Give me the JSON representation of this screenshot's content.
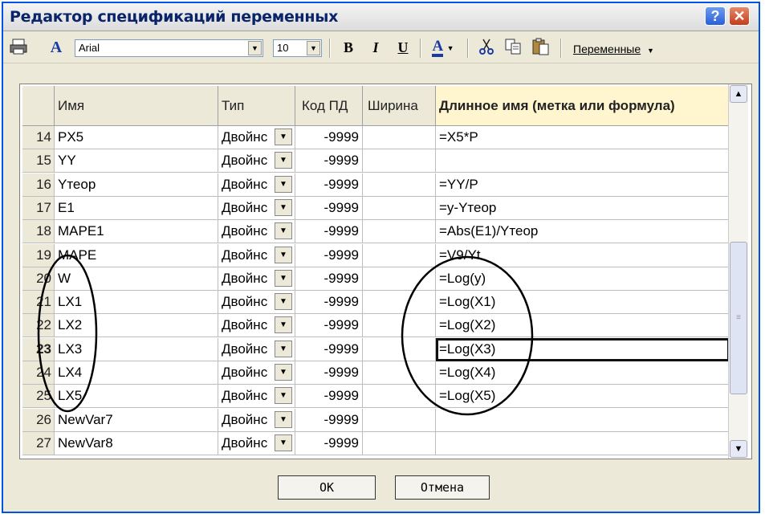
{
  "window": {
    "title": "Редактор спецификаций переменных"
  },
  "titlebar": {
    "help": "?",
    "close": "✕"
  },
  "toolbar": {
    "font_name": "Arial",
    "font_size": "10",
    "bold": "B",
    "italic": "I",
    "underline": "U",
    "font_color_letter": "A",
    "font_letter": "A",
    "variables_menu": "Переменные"
  },
  "grid": {
    "columns": [
      "Имя",
      "Тип",
      "Код ПД",
      "Ширина",
      "Длинное имя (метка или формула)"
    ],
    "rows": [
      {
        "num": "14",
        "name": "PX5",
        "type": "Двойнс",
        "code": "-9999",
        "width": "",
        "long": "=X5*P"
      },
      {
        "num": "15",
        "name": "YY",
        "type": "Двойнс",
        "code": "-9999",
        "width": "",
        "long": ""
      },
      {
        "num": "16",
        "name": "Yтеор",
        "type": "Двойнс",
        "code": "-9999",
        "width": "",
        "long": "=YY/P"
      },
      {
        "num": "17",
        "name": "E1",
        "type": "Двойнс",
        "code": "-9999",
        "width": "",
        "long": "=y-Yтеор"
      },
      {
        "num": "18",
        "name": "MAPE1",
        "type": "Двойнс",
        "code": "-9999",
        "width": "",
        "long": "=Abs(E1)/Yтеор"
      },
      {
        "num": "19",
        "name": "MAPE",
        "type": "Двойнс",
        "code": "-9999",
        "width": "",
        "long": "=V9/Yt"
      },
      {
        "num": "20",
        "name": "W",
        "type": "Двойнс",
        "code": "-9999",
        "width": "",
        "long": "=Log(y)"
      },
      {
        "num": "21",
        "name": "LX1",
        "type": "Двойнс",
        "code": "-9999",
        "width": "",
        "long": "=Log(X1)"
      },
      {
        "num": "22",
        "name": "LX2",
        "type": "Двойнс",
        "code": "-9999",
        "width": "",
        "long": "=Log(X2)"
      },
      {
        "num": "23",
        "name": "LX3",
        "type": "Двойнс",
        "code": "-9999",
        "width": "",
        "long": "=Log(X3)"
      },
      {
        "num": "24",
        "name": "LX4",
        "type": "Двойнс",
        "code": "-9999",
        "width": "",
        "long": "=Log(X4)"
      },
      {
        "num": "25",
        "name": "LX5",
        "type": "Двойнс",
        "code": "-9999",
        "width": "",
        "long": "=Log(X5)"
      },
      {
        "num": "26",
        "name": "NewVar7",
        "type": "Двойнс",
        "code": "-9999",
        "width": "",
        "long": ""
      },
      {
        "num": "27",
        "name": "NewVar8",
        "type": "Двойнс",
        "code": "-9999",
        "width": "",
        "long": ""
      }
    ],
    "active_row": "23"
  },
  "buttons": {
    "ok": "OK",
    "cancel": "Отмена"
  },
  "icons": [
    "print-icon",
    "font-icon",
    "bold-icon",
    "italic-icon",
    "underline-icon",
    "font-color-icon",
    "cut-icon",
    "copy-icon",
    "paste-icon",
    "scroll-up-icon",
    "scroll-down-icon"
  ],
  "colors": {
    "title_text": "#0a246a",
    "header_highlight": "#fff6cf",
    "close_button": "#c53c1a",
    "frame": "#0054e3"
  }
}
